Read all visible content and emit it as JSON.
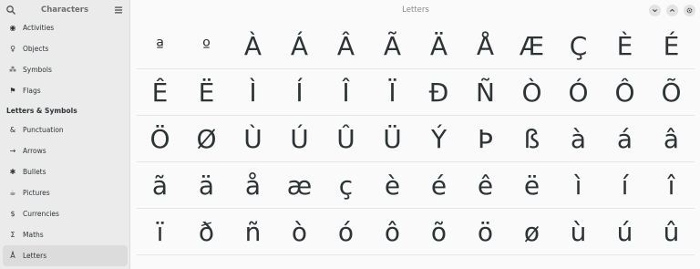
{
  "sidebar": {
    "title": "Characters",
    "items": [
      {
        "label": "Activities",
        "icon": "activities-icon",
        "glyph": "◉"
      },
      {
        "label": "Objects",
        "icon": "lightbulb-icon",
        "glyph": "♀"
      },
      {
        "label": "Symbols",
        "icon": "symbols-icon",
        "glyph": "⁂"
      },
      {
        "label": "Flags",
        "icon": "flag-icon",
        "glyph": "⚑"
      }
    ],
    "section_label": "Letters & Symbols",
    "section_items": [
      {
        "label": "Punctuation",
        "icon": "ampersand-icon",
        "glyph": "&"
      },
      {
        "label": "Arrows",
        "icon": "arrow-icon",
        "glyph": "→"
      },
      {
        "label": "Bullets",
        "icon": "bullet-icon",
        "glyph": "✱"
      },
      {
        "label": "Pictures",
        "icon": "pictures-icon",
        "glyph": "☕"
      },
      {
        "label": "Currencies",
        "icon": "currency-icon",
        "glyph": "$"
      },
      {
        "label": "Maths",
        "icon": "sigma-icon",
        "glyph": "Σ"
      },
      {
        "label": "Letters",
        "icon": "letter-icon",
        "glyph": "Å"
      }
    ]
  },
  "main": {
    "title": "Letters"
  },
  "characters": [
    [
      "ª",
      "º",
      "À",
      "Á",
      "Â",
      "Ã",
      "Ä",
      "Å",
      "Æ",
      "Ç",
      "È",
      "É"
    ],
    [
      "Ê",
      "Ë",
      "Ì",
      "Í",
      "Î",
      "Ï",
      "Ð",
      "Ñ",
      "Ò",
      "Ó",
      "Ô",
      "Õ"
    ],
    [
      "Ö",
      "Ø",
      "Ù",
      "Ú",
      "Û",
      "Ü",
      "Ý",
      "Þ",
      "ß",
      "à",
      "á",
      "â"
    ],
    [
      "ã",
      "ä",
      "å",
      "æ",
      "ç",
      "è",
      "é",
      "ê",
      "ë",
      "ì",
      "í",
      "î"
    ],
    [
      "ï",
      "ð",
      "ñ",
      "ò",
      "ó",
      "ô",
      "õ",
      "ö",
      "ø",
      "ù",
      "ú",
      "û"
    ]
  ],
  "colors": {
    "sidebar_bg": "#ebebeb",
    "selected_bg": "#dcdcdc",
    "main_bg": "#fafafa",
    "text": "#2e3436"
  }
}
